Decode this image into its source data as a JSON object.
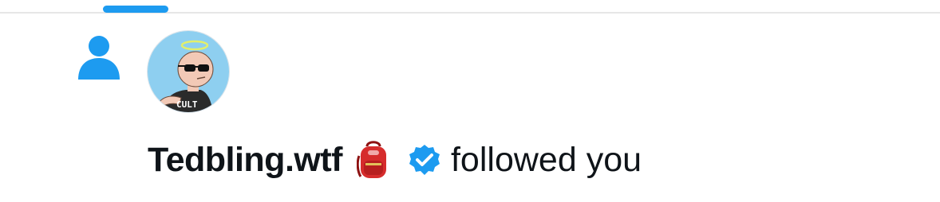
{
  "colors": {
    "accent": "#1d9bf0",
    "text": "#0f1419",
    "divider": "#e6e6e6",
    "avatar_bg": "#8ecff0"
  },
  "tab_indicator": {
    "active": true
  },
  "notification": {
    "type_icon": "person-icon",
    "avatar": {
      "icon": "avatar-bald-man-sunglasses-halo",
      "shirt_text": "CULT"
    },
    "user_name": "Tedbling.wtf",
    "name_emoji": "backpack-icon",
    "verified_icon": "verified-badge-icon",
    "action_text": "followed you"
  }
}
